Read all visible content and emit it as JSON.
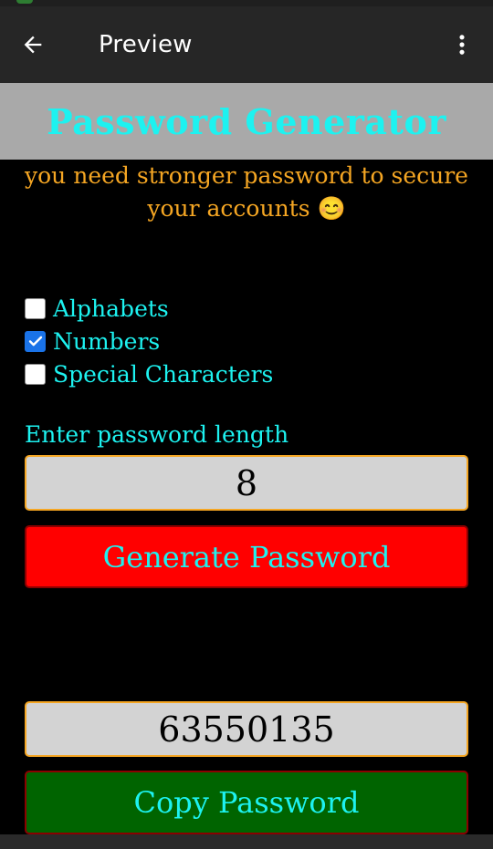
{
  "app_bar": {
    "title": "Preview",
    "back_icon": "arrow-left-icon",
    "menu_icon": "more-vertical-icon"
  },
  "header": {
    "title": "Password Generator"
  },
  "subtitle": "you need stronger password to secure your accounts 😊",
  "options": [
    {
      "label": "Alphabets",
      "checked": false
    },
    {
      "label": "Numbers",
      "checked": true
    },
    {
      "label": "Special Characters",
      "checked": false
    }
  ],
  "length": {
    "label": "Enter password length",
    "value": "8"
  },
  "generate_button": "Generate Password",
  "result": {
    "value": "63550135"
  },
  "copy_button": "Copy Password",
  "colors": {
    "app_bar": "#262626",
    "title_bar": "#a9a9a9",
    "accent_text": "#1df2f0",
    "subtitle_text": "#f5a623",
    "generate_bg": "#ff0000",
    "copy_bg": "#006400",
    "field_bg": "#d3d3d3",
    "field_border": "#f5a623",
    "checkbox_checked": "#1a73e8"
  }
}
